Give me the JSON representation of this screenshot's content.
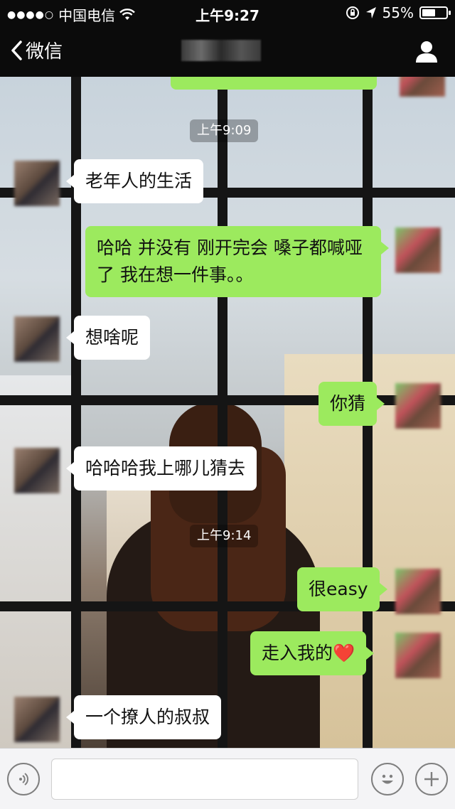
{
  "status_bar": {
    "carrier": "中国电信",
    "signal_dots": "●●●●○",
    "time": "上午9:27",
    "battery_text": "55%",
    "battery_level": 0.55
  },
  "nav": {
    "back_label": "微信"
  },
  "messages": {
    "timestamp_1": "上午9:09",
    "m1": "老年人的生活",
    "m2": "哈哈 并没有 刚开完会 嗓子都喊哑了  我在想一件事。。",
    "m3": "想啥呢",
    "m4": "你猜",
    "m5": "哈哈哈我上哪儿猜去",
    "timestamp_2": "上午9:14",
    "m6": "很easy",
    "m7_text": "走入我的",
    "m7_emoji": "❤️",
    "m8": "一个撩人的叔叔"
  },
  "input": {
    "value": "",
    "placeholder": ""
  },
  "icons": {
    "voice": "voice-icon",
    "emoji": "emoji-icon",
    "plus": "plus-icon",
    "person": "person-icon",
    "wifi": "wifi-icon",
    "lock_rotation": "rotation-lock-icon",
    "location": "location-arrow-icon"
  },
  "colors": {
    "my_bubble": "#9cea5e",
    "other_bubble": "#ffffff",
    "bar": "#0b0b0b"
  }
}
